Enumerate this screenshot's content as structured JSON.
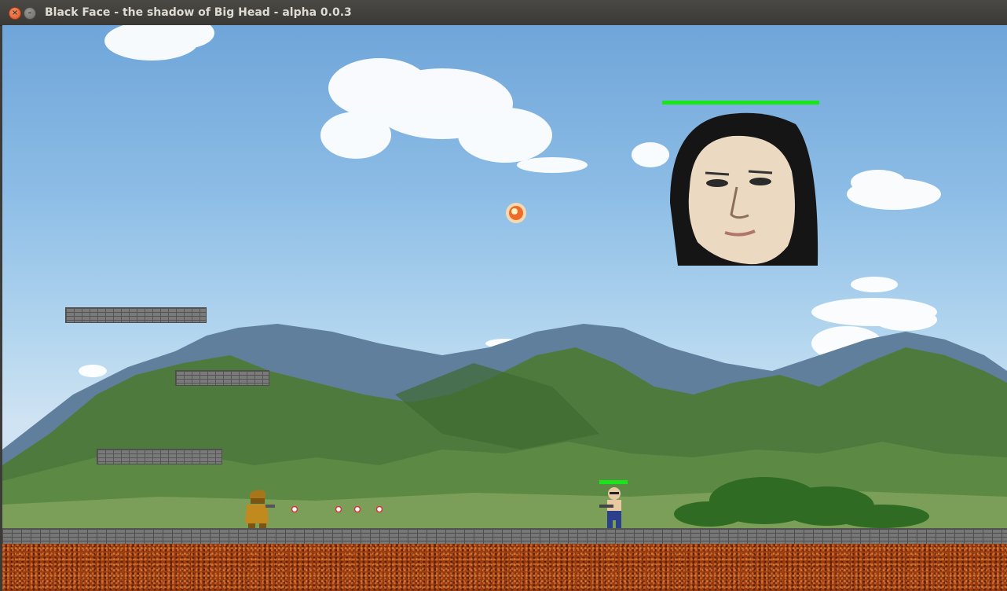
{
  "window": {
    "title": "Black Face - the shadow of Big Head - alpha 0.0.3",
    "close_glyph": "×",
    "minimize_glyph": "–"
  },
  "icons": {
    "close": "close-icon",
    "minimize": "minimize-icon"
  },
  "colors": {
    "health_bar": "#19e619",
    "close_button": "#e0501b",
    "dirt": "#9a3c10",
    "brick": "#7a7a7a"
  },
  "game": {
    "boss": {
      "name_icon": "big-head-boss",
      "health_fraction": 1.0
    },
    "enemy": {
      "name_icon": "bald-gunman-enemy",
      "health_fraction": 1.0
    },
    "player": {
      "name_icon": "hooded-gunman-player"
    },
    "fireball": {
      "name_icon": "fireball-projectile"
    },
    "bullets_count": 4,
    "platforms_count": 3
  }
}
